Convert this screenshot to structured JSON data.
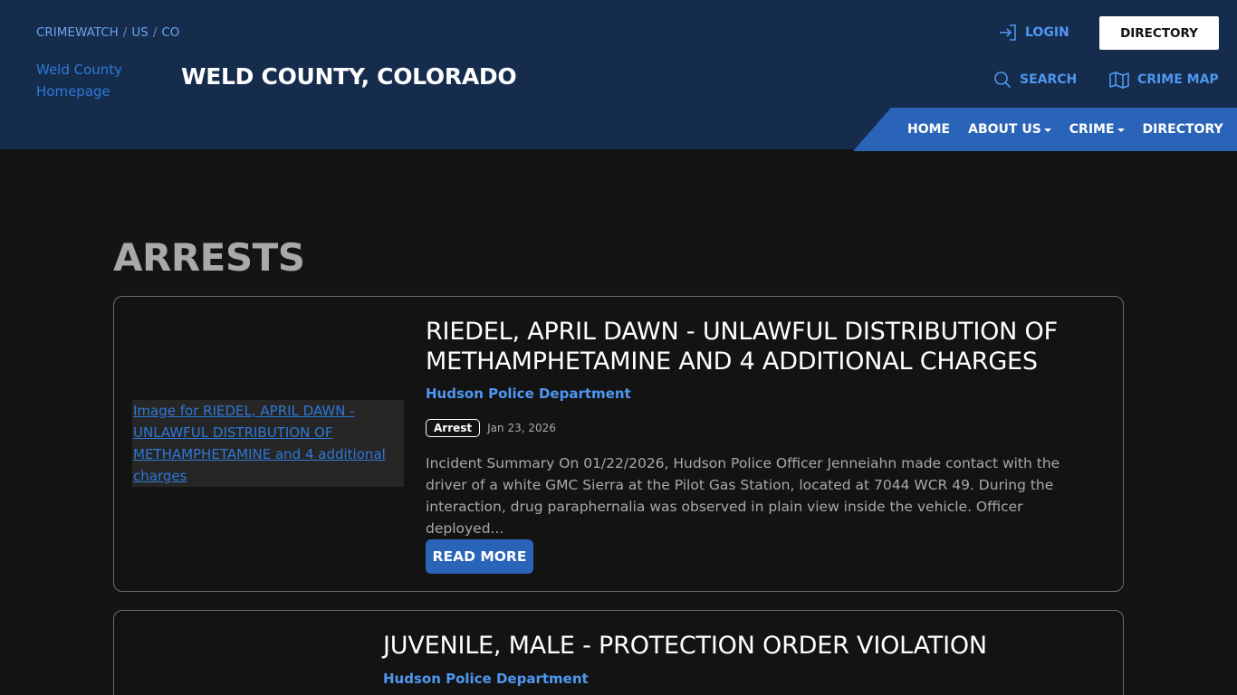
{
  "header": {
    "breadcrumb": [
      "CRIMEWATCH",
      "US",
      "CO"
    ],
    "logo_alt": "Weld County Homepage",
    "site_title": "WELD COUNTY, COLORADO",
    "login_label": "LOGIN",
    "directory_button": "DIRECTORY",
    "search_label": "SEARCH",
    "crime_map_label": "CRIME MAP",
    "nav": [
      "HOME",
      "ABOUT US",
      "CRIME",
      "DIRECTORY"
    ],
    "brand_color": "#152c4d",
    "accent_color": "#2a64b8"
  },
  "main": {
    "page_title": "ARRESTS",
    "posts": [
      {
        "image_alt": "Image for RIEDEL, APRIL DAWN - UNLAWFUL DISTRIBUTION OF METHAMPHETAMINE and 4 additional charges",
        "title": "RIEDEL, APRIL DAWN - UNLAWFUL DISTRIBUTION OF METHAMPHETAMINE AND 4 ADDITIONAL CHARGES",
        "department": "Hudson Police Department",
        "badge": "Arrest",
        "date": "Jan 23, 2026",
        "summary": "Incident Summary On 01/22/2026,  Hudson Police Officer Jenneiahn made contact with the driver of a white GMC Sierra at the Pilot Gas Station, located at 7044 WCR 49. During the interaction, drug paraphernalia was observed in plain view inside the vehicle. Officer deployed...",
        "read_more": "READ MORE"
      },
      {
        "title": "JUVENILE, MALE - PROTECTION ORDER VIOLATION",
        "department": "Hudson Police Department"
      }
    ]
  }
}
